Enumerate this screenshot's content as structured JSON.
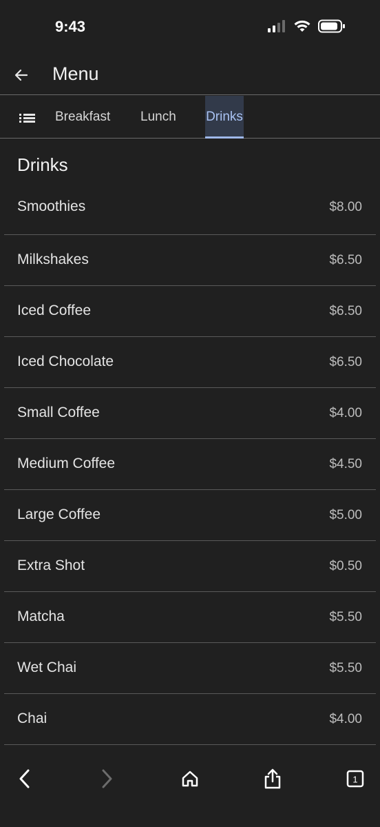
{
  "status_bar": {
    "time": "9:43"
  },
  "app_bar": {
    "title": "Menu"
  },
  "tabs": [
    {
      "label": "Breakfast",
      "active": false
    },
    {
      "label": "Lunch",
      "active": false
    },
    {
      "label": "Drinks",
      "active": true
    }
  ],
  "section": {
    "title": "Drinks"
  },
  "items": [
    {
      "name": "Smoothies",
      "price": "$8.00"
    },
    {
      "name": "Milkshakes",
      "price": "$6.50"
    },
    {
      "name": "Iced Coffee",
      "price": "$6.50"
    },
    {
      "name": "Iced Chocolate",
      "price": "$6.50"
    },
    {
      "name": "Small Coffee",
      "price": "$4.00"
    },
    {
      "name": "Medium Coffee",
      "price": "$4.50"
    },
    {
      "name": "Large Coffee",
      "price": "$5.00"
    },
    {
      "name": "Extra Shot",
      "price": "$0.50"
    },
    {
      "name": "Matcha",
      "price": "$5.50"
    },
    {
      "name": "Wet Chai",
      "price": "$5.50"
    },
    {
      "name": "Chai",
      "price": "$4.00"
    }
  ],
  "bottom_nav": {
    "tab_count": "1"
  },
  "colors": {
    "background": "#202020",
    "accent": "#a9c2f2",
    "active_tab_bg": "#323a4a"
  }
}
